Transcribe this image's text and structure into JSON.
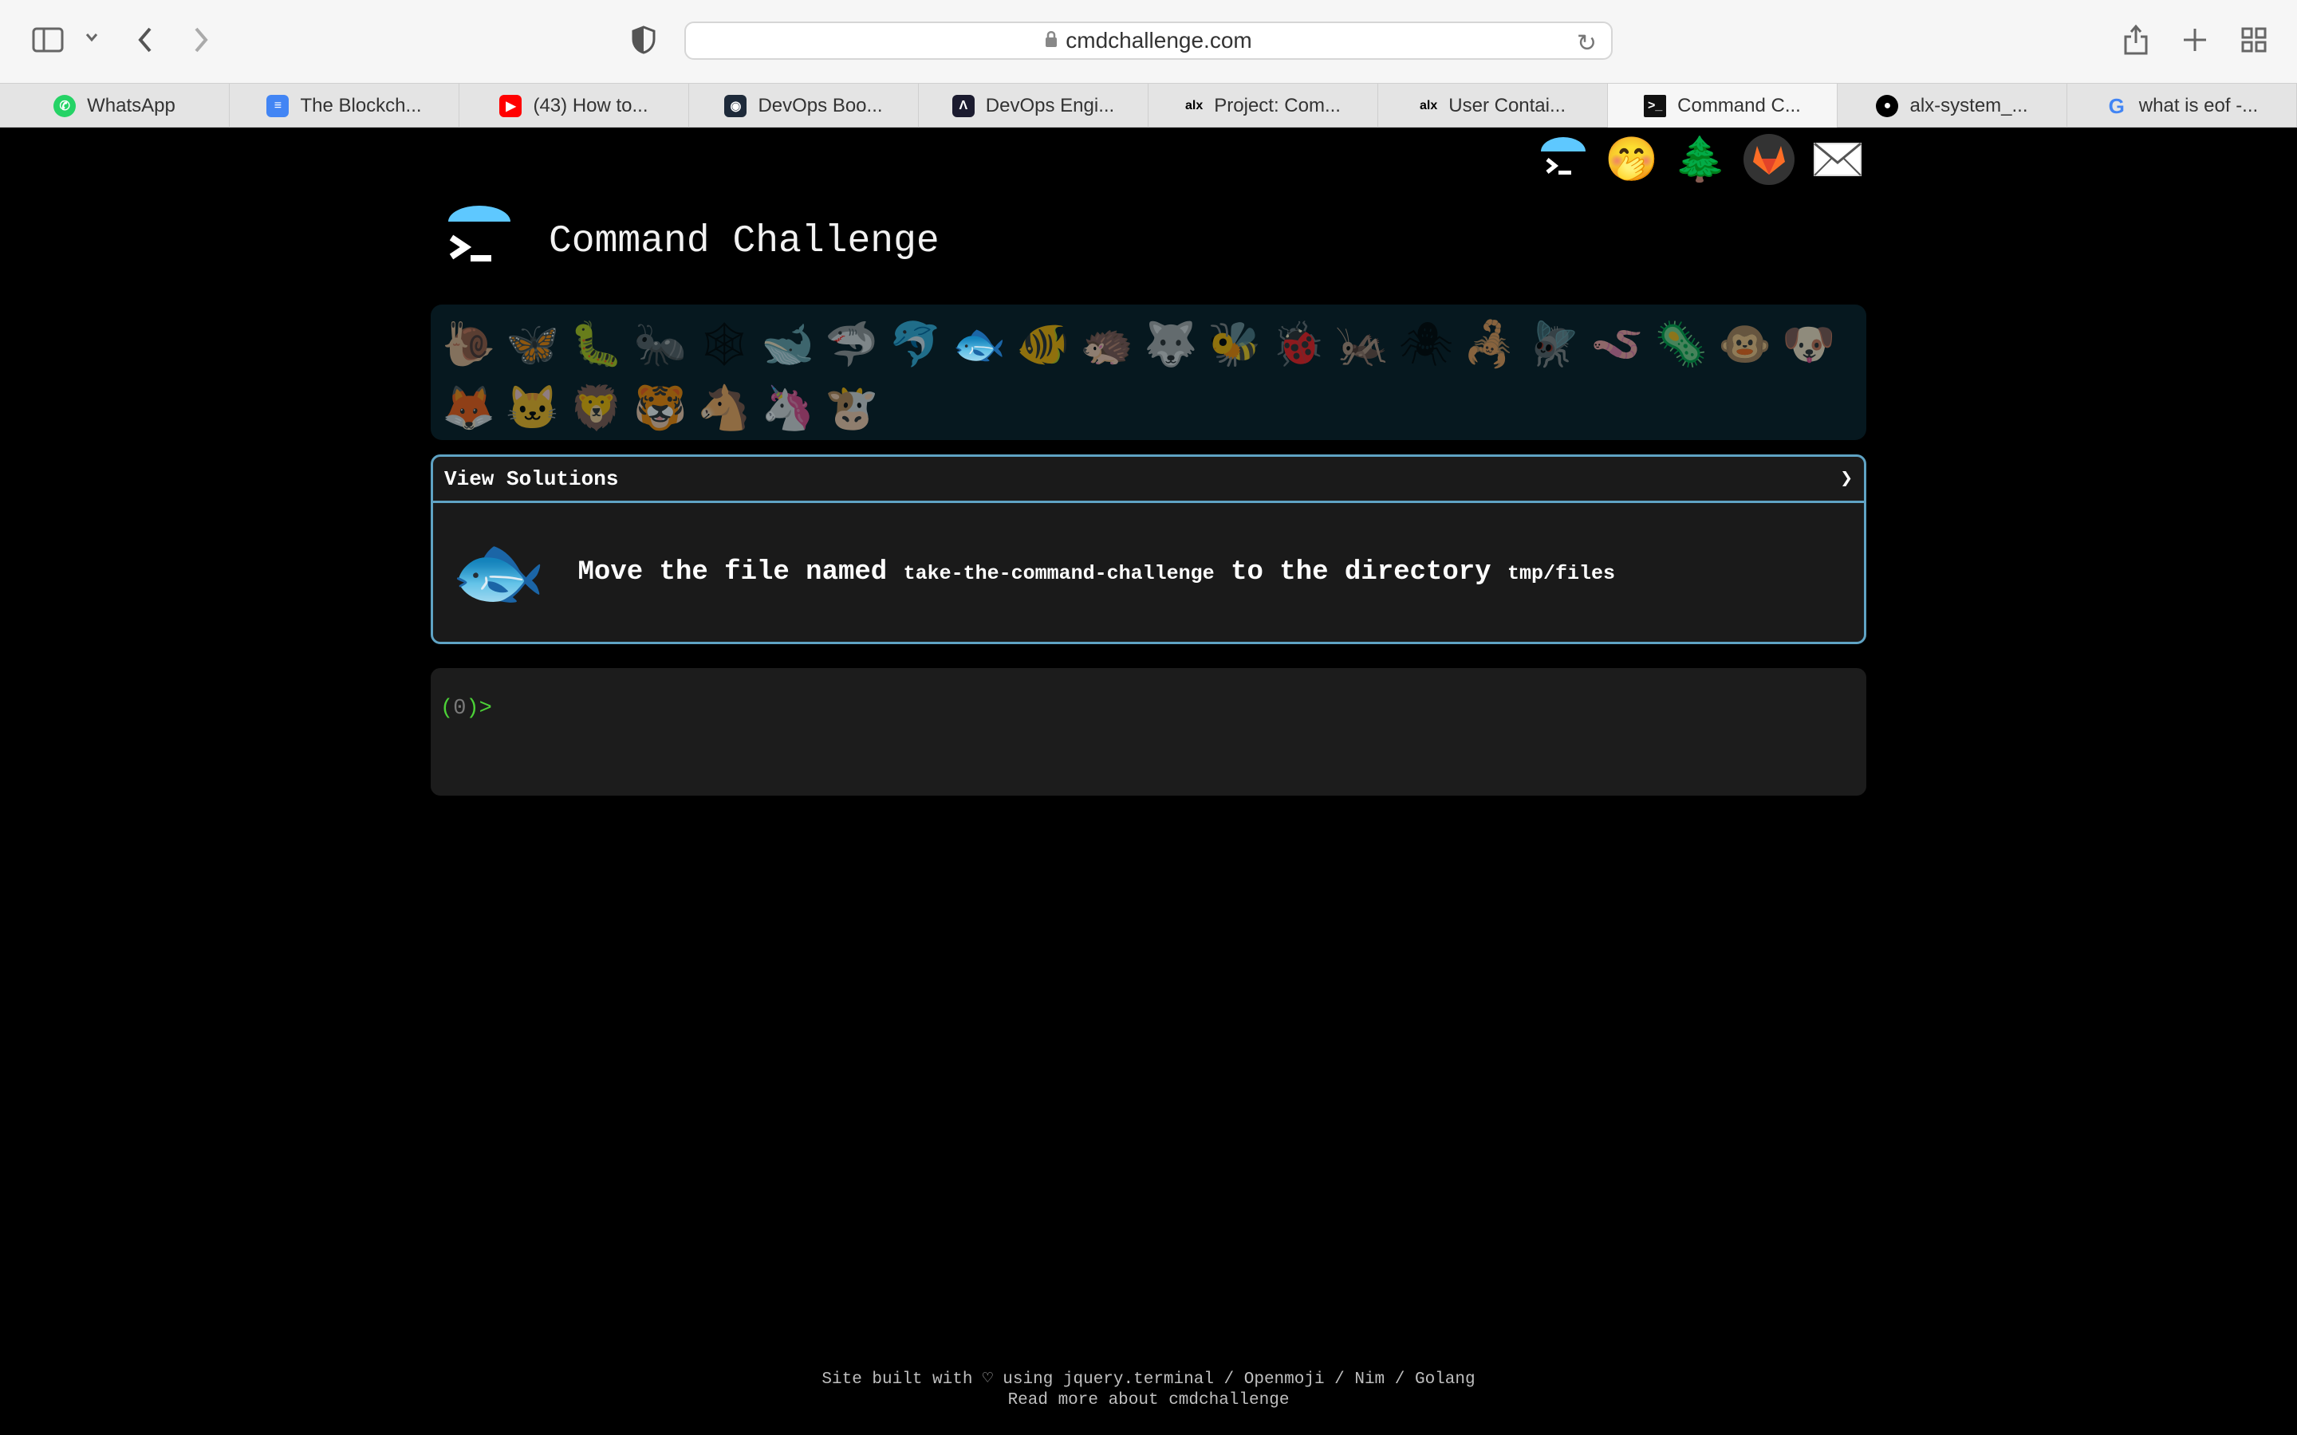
{
  "browser": {
    "url": "cmdchallenge.com",
    "tabs": [
      {
        "label": "WhatsApp",
        "favicon": "whatsapp-icon",
        "color": "#25d366"
      },
      {
        "label": "The Blockch...",
        "favicon": "google-docs-icon",
        "color": "#4285f4"
      },
      {
        "label": "(43) How to...",
        "favicon": "youtube-icon",
        "color": "#ff0000"
      },
      {
        "label": "DevOps Boo...",
        "favicon": "devops-book-icon",
        "color": "#1e2a3a"
      },
      {
        "label": "DevOps Engi...",
        "favicon": "devops-engineer-icon",
        "color": "#1b1b2f"
      },
      {
        "label": "Project: Com...",
        "favicon": "alx-icon",
        "color": "#000000"
      },
      {
        "label": "User Contai...",
        "favicon": "alx-icon",
        "color": "#000000"
      },
      {
        "label": "Command C...",
        "favicon": "terminal-icon",
        "color": "#111111"
      },
      {
        "label": "alx-system_...",
        "favicon": "github-icon",
        "color": "#000000"
      },
      {
        "label": "what is eof -...",
        "favicon": "google-icon",
        "color": "#4285f4"
      }
    ],
    "active_tab": 7
  },
  "page": {
    "title": "Command Challenge",
    "top_icons": [
      "terminal-logo-icon",
      "shush-face-icon",
      "tree-icon",
      "gitlab-icon",
      "envelope-icon"
    ],
    "animals": [
      "🐌",
      "🦋",
      "🐛",
      "🐜",
      "🕸",
      "🐋",
      "🦈",
      "🐬",
      "🐟",
      "🐠",
      "🦔",
      "🐺",
      "🐝",
      "🐞",
      "🦗",
      "🕷",
      "🦂",
      "🪰",
      "🪱",
      "🦠",
      "🐵",
      "🐶",
      "🦊",
      "🐱",
      "🦁",
      "🐯",
      "🐴",
      "🦄",
      "🐮"
    ],
    "current_animal_index": 8,
    "view_solutions": "View Solutions",
    "view_solutions_arrow": "❯",
    "challenge": {
      "icon": "🐟",
      "pre": "Move the file named ",
      "file": "take-the-command-challenge",
      "mid": " to the directory ",
      "dir": "tmp/files"
    },
    "terminal": {
      "open": "(",
      "num": "0",
      "close": ")>"
    },
    "footer": {
      "line1": "Site built with ♡ using jquery.terminal / Openmoji / Nim / Golang",
      "line2": "Read more about cmdchallenge"
    }
  }
}
